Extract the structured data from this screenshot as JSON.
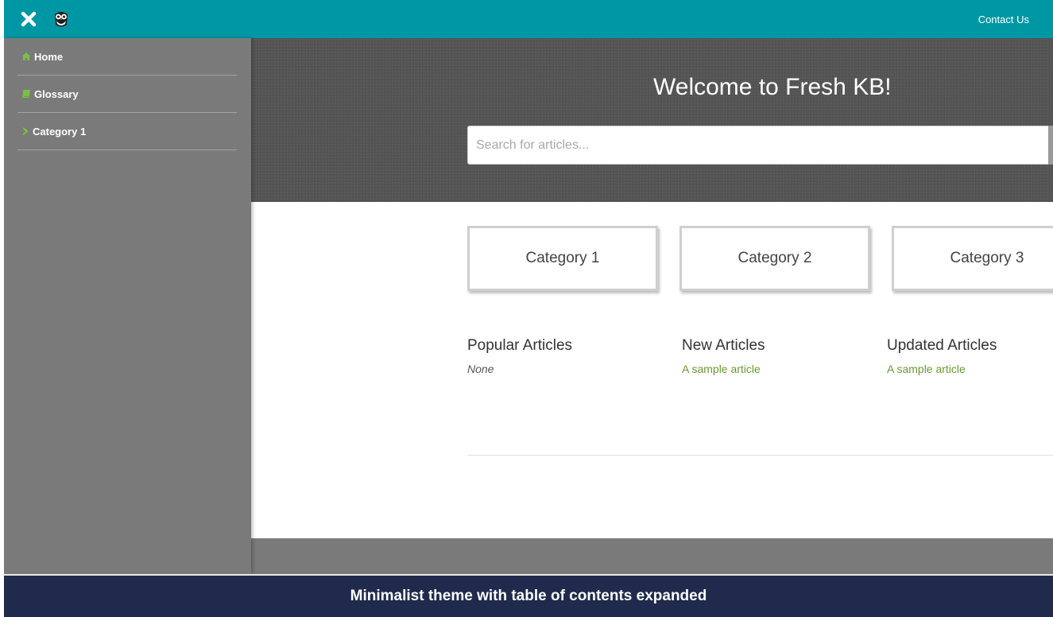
{
  "topbar": {
    "contact_label": "Contact Us",
    "accent_color": "#0097a5"
  },
  "sidebar": {
    "items": [
      {
        "label": "Home",
        "icon": "home-icon"
      },
      {
        "label": "Glossary",
        "icon": "book-icon"
      },
      {
        "label": "Category 1",
        "icon": "chevron-right-icon"
      }
    ],
    "icon_color": "#7ac143"
  },
  "hero": {
    "title": "Welcome to Fresh KB!",
    "search_placeholder": "Search for articles..."
  },
  "categories": [
    "Category 1",
    "Category 2",
    "Category 3"
  ],
  "sections": {
    "popular": {
      "title": "Popular Articles",
      "item": "None"
    },
    "new": {
      "title": "New Articles",
      "item": "A sample article"
    },
    "updated": {
      "title": "Updated Articles",
      "item": "A sample article"
    }
  },
  "caption": "Minimalist theme with table of contents expanded",
  "colors": {
    "link": "#6a9a30",
    "caption_bg": "#1f2a4c"
  }
}
